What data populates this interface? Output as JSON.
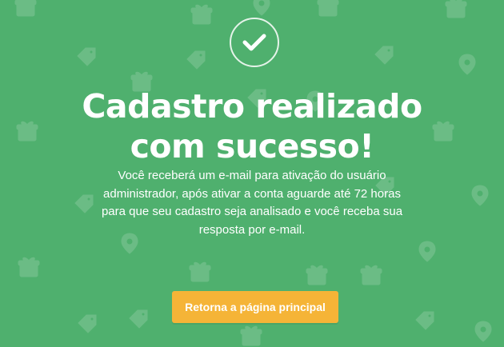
{
  "theme": {
    "background": "#4fb06e",
    "button_color": "#f5b437",
    "text_color": "#ffffff"
  },
  "icons": {
    "status": "check-icon",
    "background_pattern": [
      "gift-icon",
      "price-tag-icon",
      "location-pin-icon"
    ]
  },
  "confirmation": {
    "title_lines": [
      "Cadastro realizado",
      "com sucesso!"
    ],
    "message_lines": [
      "Você receberá um e-mail para ativação do usuário",
      "administrador, após ativar a conta aguarde até 72 horas",
      "para que seu cadastro seja analisado e você receba sua",
      "resposta por e-mail."
    ],
    "button_label": "Retorna a página principal"
  }
}
